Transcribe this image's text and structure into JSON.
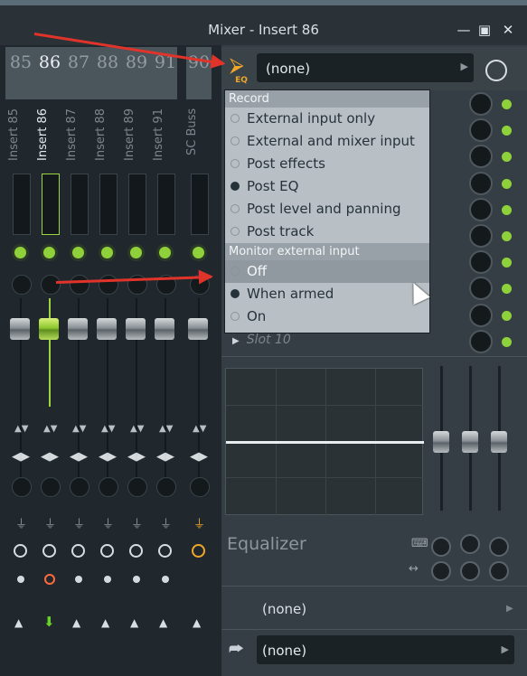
{
  "window": {
    "title": "Mixer - Insert 86",
    "min_icon": "minimize-icon",
    "max_icon": "maximize-icon",
    "close_icon": "close-icon"
  },
  "track_numbers": [
    "85",
    "86",
    "87",
    "88",
    "89",
    "91"
  ],
  "scbuss_number": "90",
  "strips": [
    {
      "name": "Insert 85",
      "selected": false
    },
    {
      "name": "Insert 86",
      "selected": true
    },
    {
      "name": "Insert 87",
      "selected": false
    },
    {
      "name": "Insert 88",
      "selected": false
    },
    {
      "name": "Insert 89",
      "selected": false
    },
    {
      "name": "Insert 91",
      "selected": false
    }
  ],
  "scbuss_name": "SC Buss",
  "input": {
    "eq_label": "EQ",
    "selected": "(none)"
  },
  "input_menu": {
    "record_header": "Record",
    "record_items": [
      "External input only",
      "External and mixer input",
      "Post effects",
      "Post EQ",
      "Post level and panning",
      "Post track"
    ],
    "record_selected_index": 3,
    "monitor_header": "Monitor external input",
    "monitor_items": [
      "Off",
      "When armed",
      "On"
    ],
    "monitor_selected_index": 1,
    "monitor_hover_index": 0
  },
  "slots": {
    "slot10_label": "Slot 10"
  },
  "equalizer": {
    "title": "Equalizer",
    "band_count": 3
  },
  "output": {
    "send_label": "(none)",
    "output_label": "(none)"
  },
  "colors": {
    "accent_green": "#8fd13a",
    "accent_orange": "#f0a629",
    "annotation_red": "#e0332a",
    "record_red": "#ff6a3d"
  }
}
